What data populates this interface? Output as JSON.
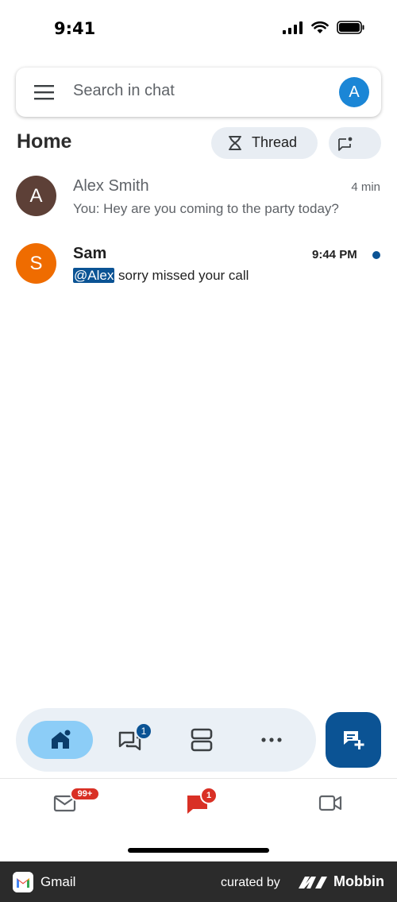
{
  "status_bar": {
    "time": "9:41"
  },
  "search": {
    "placeholder": "Search in chat",
    "account_initial": "A"
  },
  "header": {
    "title": "Home",
    "thread_chip_label": "Thread"
  },
  "conversations": [
    {
      "initial": "A",
      "name": "Alex Smith",
      "time": "4 min",
      "snippet": "You: Hey are you coming to the party today?",
      "avatar_color": "#5d4037",
      "unread": false
    },
    {
      "initial": "S",
      "name": "Sam",
      "time": "9:44 PM",
      "mention": "@Alex",
      "snippet": " sorry missed your call",
      "avatar_color": "#ef6c00",
      "unread": true
    }
  ],
  "bottom_nav": {
    "items": [
      "home-icon",
      "chat-icon",
      "spaces-icon",
      "more-icon"
    ],
    "chat_badge": "1"
  },
  "app_tabs": {
    "mail_badge": "99+",
    "chat_badge": "1"
  },
  "footer": {
    "app_name": "Gmail",
    "curated_by": "curated by",
    "brand": "Mobbin"
  },
  "colors": {
    "accent": "#0b5394",
    "home_active": "#8ccdf7",
    "badge_red": "#d93025"
  }
}
